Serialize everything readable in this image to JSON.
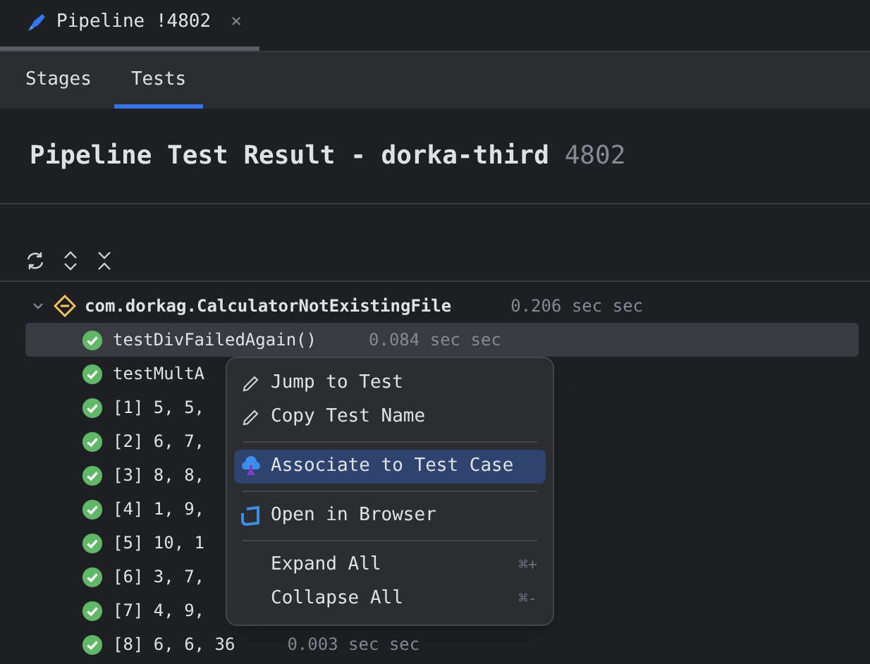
{
  "editor_tab": {
    "title": "Pipeline !4802",
    "close": "×"
  },
  "tabs": [
    {
      "label": "Stages",
      "selected": false
    },
    {
      "label": "Tests",
      "selected": true
    }
  ],
  "heading": {
    "title": "Pipeline Test Result - dorka-third",
    "number": "4802"
  },
  "tree": {
    "suite": {
      "name": "com.dorkag.CalculatorNotExistingFile",
      "time": "0.206 sec sec",
      "expanded": true
    },
    "rows": [
      {
        "name": "testDivFailedAgain()",
        "time": "0.084 sec sec",
        "selected": true
      },
      {
        "name": "testMultA",
        "selected": false
      },
      {
        "name": "[1] 5, 5,",
        "selected": false
      },
      {
        "name": "[2] 6, 7,",
        "selected": false
      },
      {
        "name": "[3] 8, 8,",
        "selected": false
      },
      {
        "name": "[4] 1, 9,",
        "selected": false
      },
      {
        "name": "[5] 10, 1",
        "selected": false
      },
      {
        "name": "[6] 3, 7,",
        "selected": false
      },
      {
        "name": "[7] 4, 9,",
        "selected": false
      },
      {
        "name": "[8] 6, 6, 36",
        "time": "0.003 sec sec",
        "selected": false
      }
    ]
  },
  "context_menu": [
    {
      "kind": "item",
      "label": "Jump to Test",
      "selected": false
    },
    {
      "kind": "item",
      "label": "Copy Test Name",
      "selected": false
    },
    {
      "kind": "separator"
    },
    {
      "kind": "item",
      "label": "Associate to Test Case",
      "selected": true
    },
    {
      "kind": "separator"
    },
    {
      "kind": "item",
      "label": "Open in Browser",
      "selected": false
    },
    {
      "kind": "separator"
    },
    {
      "kind": "item",
      "label": "Expand All",
      "shortcut": "⌘+",
      "selected": false
    },
    {
      "kind": "item",
      "label": "Collapse All",
      "shortcut": "⌘-",
      "selected": false
    }
  ]
}
